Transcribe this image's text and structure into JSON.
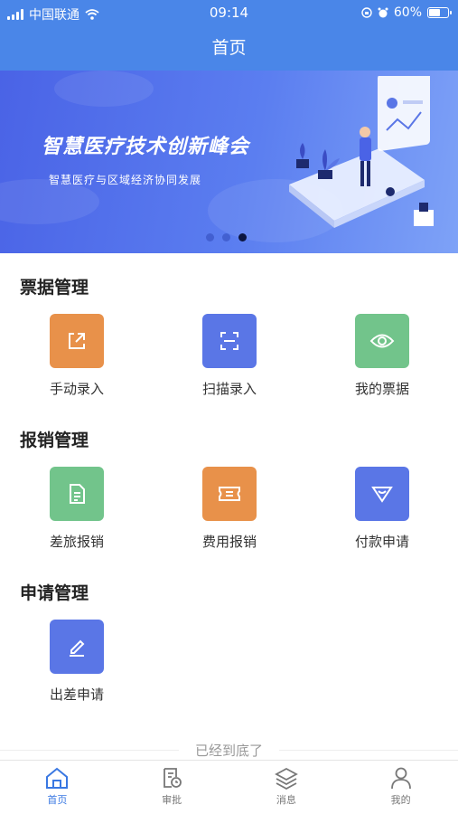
{
  "status_bar": {
    "carrier": "中国联通",
    "time": "09:14",
    "battery": "60%"
  },
  "header": {
    "title": "首页"
  },
  "banner": {
    "title": "智慧医疗技术创新峰会",
    "subtitle": "智慧医疗与区域经济协同发展",
    "dots_total": 3,
    "active_dot": 3
  },
  "sections": [
    {
      "title": "票据管理",
      "items": [
        {
          "label": "手动录入",
          "icon": "share-box-icon",
          "color": "#e8914a"
        },
        {
          "label": "扫描录入",
          "icon": "scan-icon",
          "color": "#5a76e6"
        },
        {
          "label": "我的票据",
          "icon": "eye-icon",
          "color": "#72c48b"
        }
      ]
    },
    {
      "title": "报销管理",
      "items": [
        {
          "label": "差旅报销",
          "icon": "document-icon",
          "color": "#72c48b"
        },
        {
          "label": "费用报销",
          "icon": "ticket-icon",
          "color": "#e8914a"
        },
        {
          "label": "付款申请",
          "icon": "diamond-icon",
          "color": "#5a76e6"
        }
      ]
    },
    {
      "title": "申请管理",
      "items": [
        {
          "label": "出差申请",
          "icon": "edit-icon",
          "color": "#5a76e6"
        }
      ]
    }
  ],
  "footer_text": "已经到底了",
  "tabbar": [
    {
      "label": "首页",
      "icon": "home-icon",
      "active": true
    },
    {
      "label": "审批",
      "icon": "approval-icon",
      "active": false
    },
    {
      "label": "消息",
      "icon": "layers-icon",
      "active": false
    },
    {
      "label": "我的",
      "icon": "user-icon",
      "active": false
    }
  ],
  "colors": {
    "primary": "#4a86e8",
    "active_tab": "#3a78e2"
  }
}
